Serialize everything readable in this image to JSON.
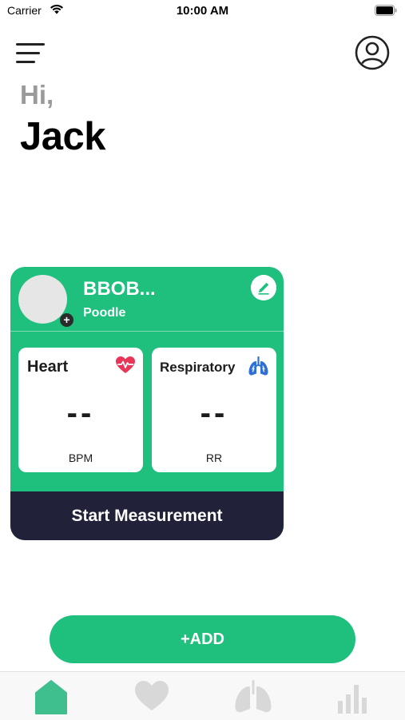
{
  "status_bar": {
    "carrier": "Carrier",
    "time": "10:00 AM"
  },
  "header": {
    "greeting": "Hi,",
    "user_name": "Jack"
  },
  "pet_card": {
    "name": "BBOB...",
    "breed": "Poodle",
    "metrics": [
      {
        "title": "Heart",
        "value": "--",
        "unit": "BPM",
        "icon": "heart-pulse-icon"
      },
      {
        "title": "Respiratory",
        "value": "--",
        "unit": "RR",
        "icon": "lungs-icon"
      }
    ],
    "start_label": "Start Measurement"
  },
  "add_label": "+ADD",
  "tabs": [
    {
      "icon": "home-icon",
      "active": true
    },
    {
      "icon": "heart-icon",
      "active": false
    },
    {
      "icon": "lungs-icon",
      "active": false
    },
    {
      "icon": "bar-chart-icon",
      "active": false
    }
  ],
  "colors": {
    "accent": "#1fbf7e",
    "dark": "#22213a",
    "heart": "#e8365a",
    "lungs": "#2f6fd6",
    "inactive_tab": "#d8d8d8"
  }
}
